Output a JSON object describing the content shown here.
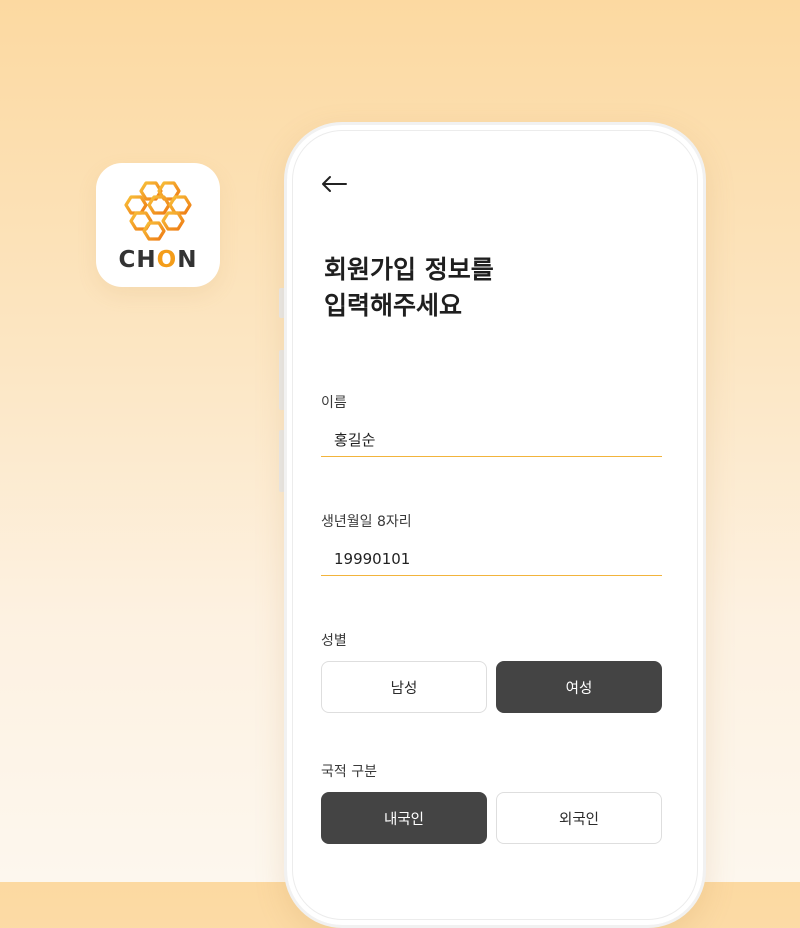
{
  "app_icon": {
    "brand_prefix": "CH",
    "brand_accent": "O",
    "brand_suffix": "N",
    "icon": "honeycomb-logo-icon"
  },
  "screen": {
    "back_icon": "arrow-left-icon",
    "title_line1": "회원가입 정보를",
    "title_line2": "입력해주세요"
  },
  "form": {
    "name_label": "이름",
    "name_value": "홍길순",
    "birth_label": "생년월일 8자리",
    "birth_value": "19990101",
    "gender_label": "성별",
    "gender_options": [
      "남성",
      "여성"
    ],
    "gender_selected": "여성",
    "nationality_label": "국적 구분",
    "nationality_options": [
      "내국인",
      "외국인"
    ],
    "nationality_selected": "내국인"
  },
  "colors": {
    "accent": "#f2b43c",
    "selected_bg": "#444444",
    "brand_orange": "#f49d1a"
  }
}
